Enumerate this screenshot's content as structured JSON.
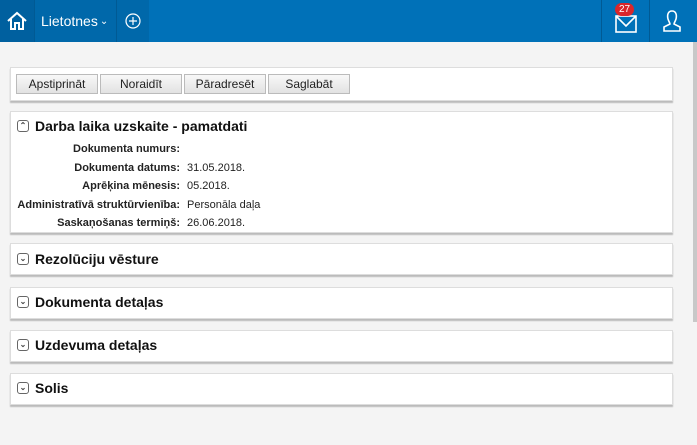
{
  "topbar": {
    "apps_label": "Lietotnes",
    "mail_count": "27"
  },
  "toolbar": {
    "buttons": [
      "Apstiprināt",
      "Noraidīt",
      "Pāradresēt",
      "Saglabāt"
    ]
  },
  "main_section": {
    "title": "Darba laika uzskaite - pamatdati",
    "fields": [
      {
        "label": "Dokumenta numurs:",
        "value": ""
      },
      {
        "label": "Dokumenta datums:",
        "value": "31.05.2018."
      },
      {
        "label": "Aprēķina mēnesis:",
        "value": "05.2018."
      },
      {
        "label": "Administratīvā struktūrvienība:",
        "value": "Personāla daļa"
      },
      {
        "label": "Saskaņošanas termiņš:",
        "value": "26.06.2018."
      }
    ]
  },
  "sections": [
    "Rezolūciju vēsture",
    "Dokumenta detaļas",
    "Uzdevuma detaļas",
    "Solis"
  ]
}
